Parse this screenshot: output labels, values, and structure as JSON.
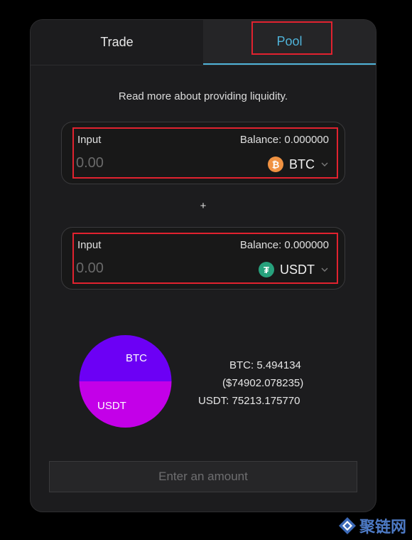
{
  "tabs": [
    {
      "label": "Trade",
      "active": false
    },
    {
      "label": "Pool",
      "active": true
    }
  ],
  "note": "Read more about providing liquidity.",
  "inputs": [
    {
      "label": "Input",
      "balance": "Balance: 0.000000",
      "placeholder": "0.00",
      "token": "BTC",
      "icon": "bitcoin-icon"
    },
    {
      "label": "Input",
      "balance": "Balance: 0.000000",
      "placeholder": "0.00",
      "token": "USDT",
      "icon": "tether-icon"
    }
  ],
  "plus": "+",
  "chart_data": {
    "type": "pie",
    "categories": [
      "BTC",
      "USDT"
    ],
    "values": [
      50,
      50
    ],
    "colors": [
      "#6c00f5",
      "#c300e8"
    ]
  },
  "stats": {
    "btc": "BTC: 5.494134",
    "btc_usd": "($74902.078235)",
    "usdt": "USDT: 75213.175770"
  },
  "cta": "Enter an amount",
  "watermark": "聚链网",
  "colors": {
    "accent": "#4fb3d9",
    "highlight": "#e1222f",
    "btc": "#f09242",
    "usdt": "#27a17c"
  }
}
